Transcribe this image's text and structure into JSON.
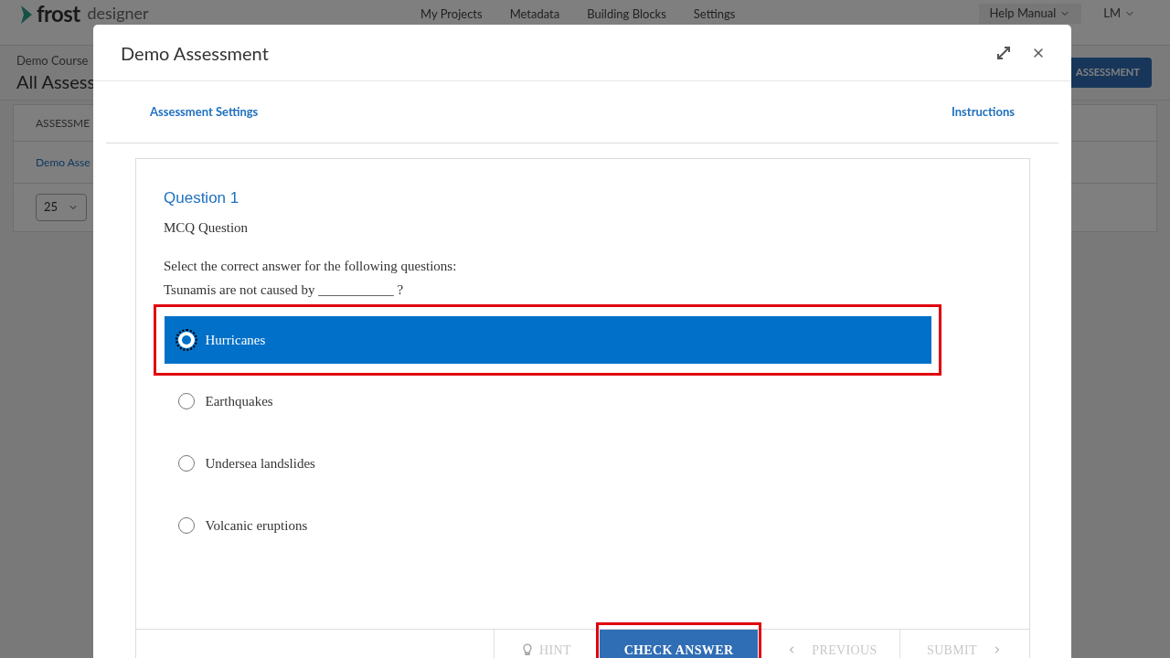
{
  "app_header": {
    "logo": "frost",
    "logo_suffix": "designer",
    "nav": [
      "My Projects",
      "Metadata",
      "Building Blocks",
      "Settings"
    ],
    "help_menu": "Help Manual",
    "user_menu": "LM"
  },
  "page": {
    "breadcrumb": "Demo Course",
    "title": "All Assess",
    "action_button": "ASSESSMENT",
    "table_header": "ASSESSME",
    "table_row": "Demo Asse",
    "page_size": "25"
  },
  "modal": {
    "title": "Demo Assessment",
    "links": [
      "Assessment Settings",
      "Instructions"
    ],
    "question": {
      "heading": "Question 1",
      "type": "MCQ Question",
      "prompt": "Select the correct answer for the following questions:",
      "text": "Tsunamis are not caused by ___________ ?",
      "options": [
        {
          "label": "Hurricanes",
          "selected": true,
          "highlighted": true
        },
        {
          "label": "Earthquakes",
          "selected": false,
          "highlighted": false
        },
        {
          "label": "Undersea landslides",
          "selected": false,
          "highlighted": false
        },
        {
          "label": "Volcanic eruptions",
          "selected": false,
          "highlighted": false
        }
      ]
    },
    "footer_buttons": [
      {
        "label": "HINT",
        "kind": "hint",
        "disabled": true,
        "highlighted": false
      },
      {
        "label": "CHECK ANSWER",
        "kind": "primary",
        "disabled": false,
        "highlighted": true
      },
      {
        "label": "PREVIOUS",
        "kind": "previous",
        "disabled": true,
        "highlighted": false
      },
      {
        "label": "SUBMIT",
        "kind": "next",
        "disabled": true,
        "highlighted": false
      }
    ]
  }
}
